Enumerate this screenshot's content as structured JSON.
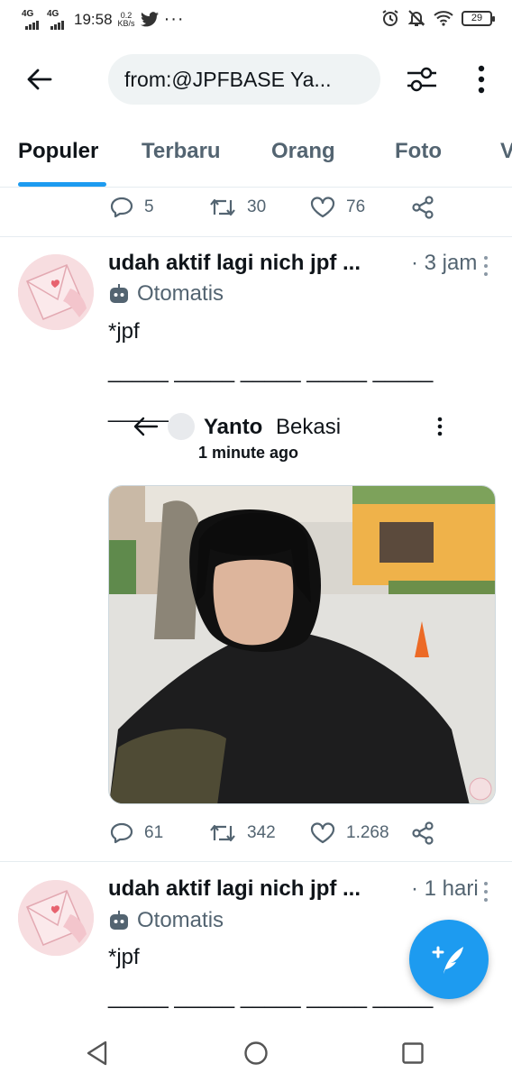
{
  "status_bar": {
    "net1": "4G",
    "net2": "4G",
    "time": "19:58",
    "speed_value": "0.2",
    "speed_unit": "KB/s",
    "battery": "29",
    "icons": [
      "twitter-icon",
      "more-dots-icon",
      "alarm-icon",
      "notifications-off-icon",
      "wifi-icon",
      "battery-icon"
    ]
  },
  "search": {
    "query": "from:@JPFBASE Ya..."
  },
  "tabs": [
    {
      "label": "Populer",
      "active": true
    },
    {
      "label": "Terbaru"
    },
    {
      "label": "Orang"
    },
    {
      "label": "Foto"
    },
    {
      "label": "V"
    }
  ],
  "prev_tweet_actions": {
    "replies": "5",
    "retweets": "30",
    "likes": "76"
  },
  "tweets": [
    {
      "name": "udah aktif lagi nich jpf ...",
      "time": "· 3 jam",
      "automated_label": "Otomatis",
      "text_line1": "*jpf",
      "text_line2": "_____ _____ _____ _____ _____",
      "text_line3": "_____",
      "quote": {
        "name": "Yanto",
        "suffix": "Bekasi",
        "time": "1 minute ago"
      },
      "actions": {
        "replies": "61",
        "retweets": "342",
        "likes": "1.268"
      }
    },
    {
      "name": "udah aktif lagi nich jpf ...",
      "time": "· 1 hari",
      "automated_label": "Otomatis",
      "text_line1": "*jpf",
      "text_line2": "_____ _____ _____ _____ _____"
    }
  ],
  "colors": {
    "accent": "#1d9bf0",
    "text_primary": "#0f1419",
    "text_secondary": "#536471",
    "divider": "#e6ecf0"
  }
}
